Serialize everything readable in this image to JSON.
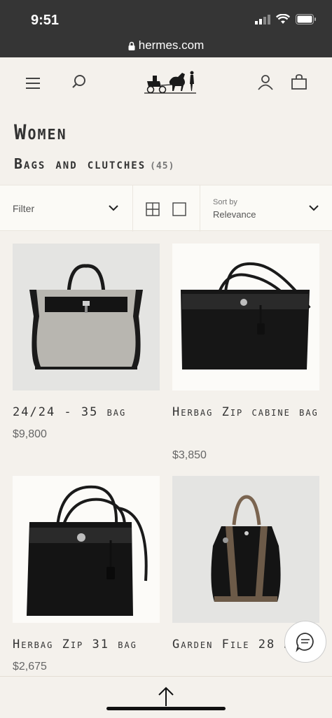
{
  "status_bar": {
    "time": "9:51"
  },
  "browser": {
    "url": "hermes.com"
  },
  "page": {
    "title": "Women",
    "subtitle": "Bags and clutches",
    "count": "(45)"
  },
  "filters": {
    "filter_label": "Filter",
    "sort_label": "Sort by",
    "sort_value": "Relevance"
  },
  "products": [
    {
      "name": "24/24 - 35 bag",
      "price": "$9,800"
    },
    {
      "name": "Herbag Zip cabine bag",
      "price": "$3,850"
    },
    {
      "name": "Herbag Zip 31 bag",
      "price": "$2,675"
    },
    {
      "name": "Garden File 28 bag",
      "price": ""
    }
  ],
  "colors": {
    "background": "#f4f1ec",
    "dark_bar": "#353535",
    "text": "#333333"
  },
  "icons": [
    "menu-icon",
    "search-icon",
    "logo",
    "account-icon",
    "shopping-bag-icon",
    "chevron-down-icon",
    "grid-view-icon",
    "single-view-icon",
    "chat-icon",
    "arrow-up-icon"
  ]
}
